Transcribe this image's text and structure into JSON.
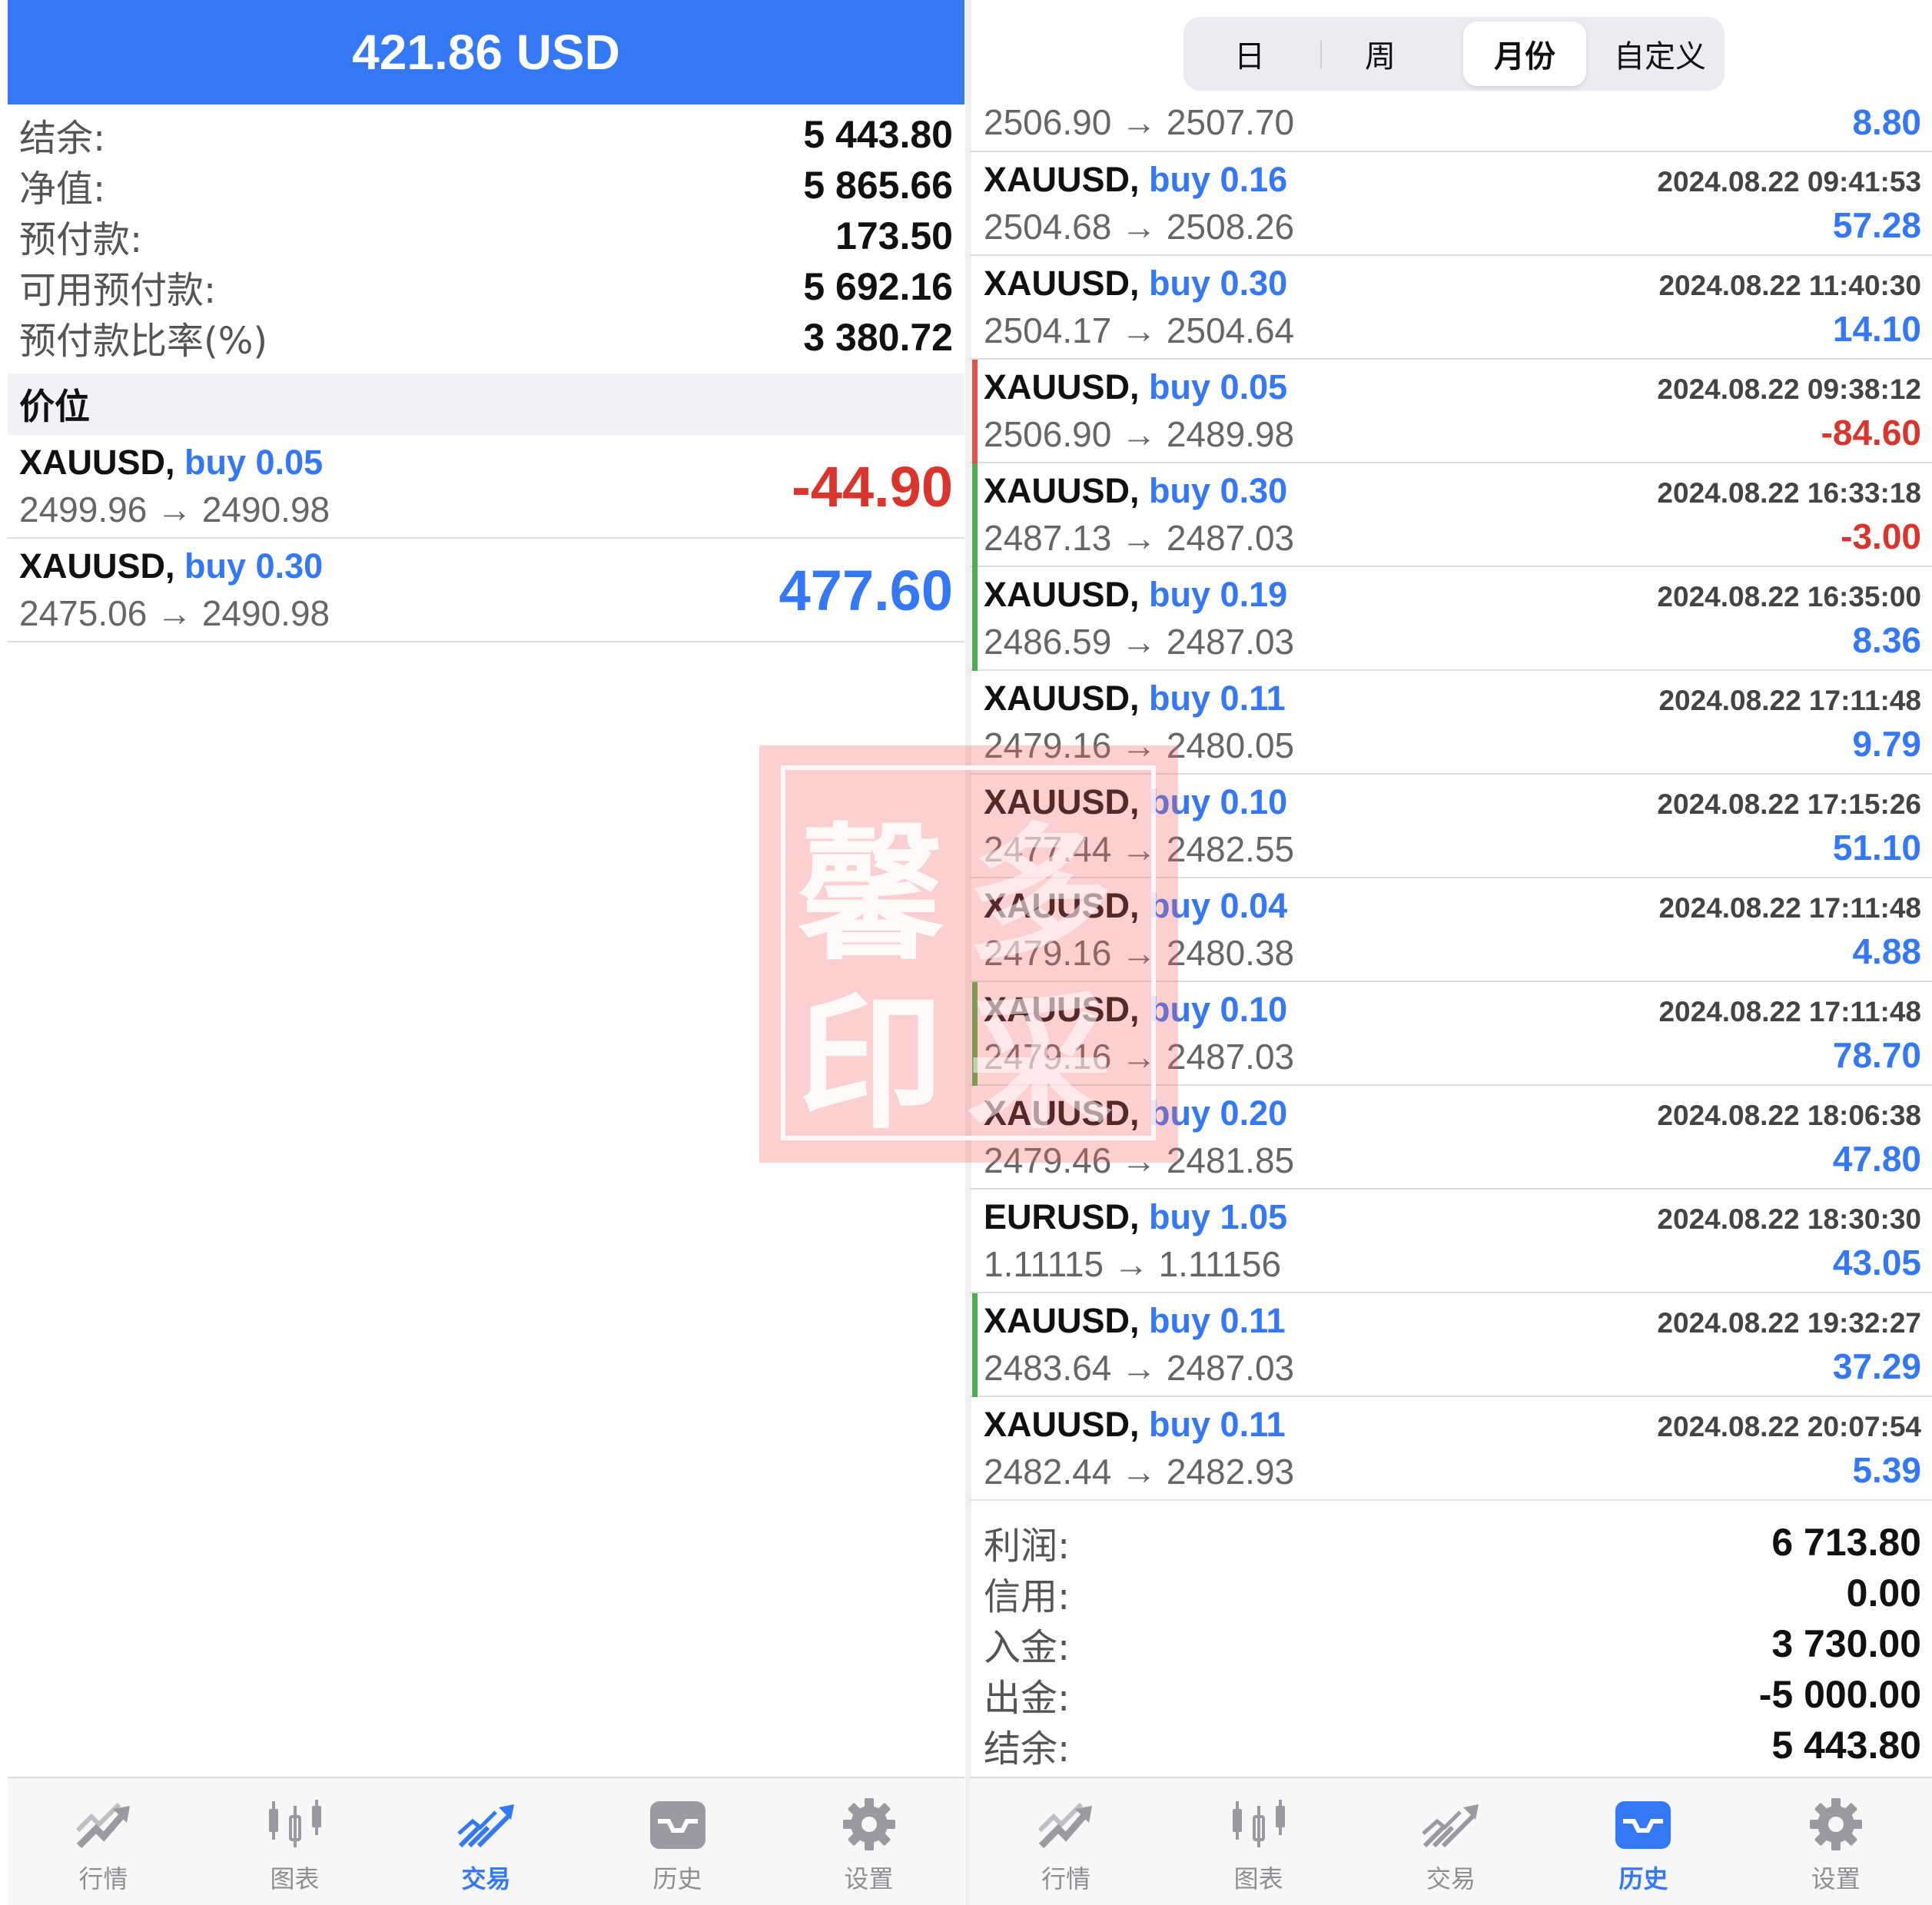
{
  "left": {
    "header": "421.86 USD",
    "summary": [
      {
        "label": "结余:",
        "value": "5 443.80"
      },
      {
        "label": "净值:",
        "value": "5 865.66"
      },
      {
        "label": "预付款:",
        "value": "173.50"
      },
      {
        "label": "可用预付款:",
        "value": "5 692.16"
      },
      {
        "label": "预付款比率(%)",
        "value": "3 380.72"
      }
    ],
    "section_title": "价位",
    "positions": [
      {
        "symbol": "XAUUSD,",
        "action": "buy 0.05",
        "prices": "2499.96 → 2490.98",
        "profit": "-44.90",
        "sign": "neg"
      },
      {
        "symbol": "XAUUSD,",
        "action": "buy 0.30",
        "prices": "2475.06 → 2490.98",
        "profit": "477.60",
        "sign": "pos"
      }
    ]
  },
  "right": {
    "segments": [
      "日",
      "周",
      "月份",
      "自定义"
    ],
    "active_segment": "月份",
    "partial_row": {
      "prices": "2506.90 → 2507.70",
      "profit": "8.80"
    },
    "deals": [
      {
        "symbol": "XAUUSD,",
        "action": "buy 0.16",
        "time": "2024.08.22 09:41:53",
        "prices": "2504.68 → 2508.26",
        "profit": "57.28",
        "sign": "pos",
        "mark": ""
      },
      {
        "symbol": "XAUUSD,",
        "action": "buy 0.30",
        "time": "2024.08.22 11:40:30",
        "prices": "2504.17 → 2504.64",
        "profit": "14.10",
        "sign": "pos",
        "mark": ""
      },
      {
        "symbol": "XAUUSD,",
        "action": "buy 0.05",
        "time": "2024.08.22 09:38:12",
        "prices": "2506.90 → 2489.98",
        "profit": "-84.60",
        "sign": "neg",
        "mark": "#e0524a"
      },
      {
        "symbol": "XAUUSD,",
        "action": "buy 0.30",
        "time": "2024.08.22 16:33:18",
        "prices": "2487.13 → 2487.03",
        "profit": "-3.00",
        "sign": "neg",
        "mark": "#4cb050"
      },
      {
        "symbol": "XAUUSD,",
        "action": "buy 0.19",
        "time": "2024.08.22 16:35:00",
        "prices": "2486.59 → 2487.03",
        "profit": "8.36",
        "sign": "pos",
        "mark": "#4cb050"
      },
      {
        "symbol": "XAUUSD,",
        "action": "buy 0.11",
        "time": "2024.08.22 17:11:48",
        "prices": "2479.16 → 2480.05",
        "profit": "9.79",
        "sign": "pos",
        "mark": ""
      },
      {
        "symbol": "XAUUSD,",
        "action": "buy 0.10",
        "time": "2024.08.22 17:15:26",
        "prices": "2477.44 → 2482.55",
        "profit": "51.10",
        "sign": "pos",
        "mark": ""
      },
      {
        "symbol": "XAUUSD,",
        "action": "buy 0.04",
        "time": "2024.08.22 17:11:48",
        "prices": "2479.16 → 2480.38",
        "profit": "4.88",
        "sign": "pos",
        "mark": ""
      },
      {
        "symbol": "XAUUSD,",
        "action": "buy 0.10",
        "time": "2024.08.22 17:11:48",
        "prices": "2479.16 → 2487.03",
        "profit": "78.70",
        "sign": "pos",
        "mark": "#4cb050"
      },
      {
        "symbol": "XAUUSD,",
        "action": "buy 0.20",
        "time": "2024.08.22 18:06:38",
        "prices": "2479.46 → 2481.85",
        "profit": "47.80",
        "sign": "pos",
        "mark": ""
      },
      {
        "symbol": "EURUSD,",
        "action": "buy 1.05",
        "time": "2024.08.22 18:30:30",
        "prices": "1.11115 → 1.11156",
        "profit": "43.05",
        "sign": "pos",
        "mark": ""
      },
      {
        "symbol": "XAUUSD,",
        "action": "buy 0.11",
        "time": "2024.08.22 19:32:27",
        "prices": "2483.64 → 2487.03",
        "profit": "37.29",
        "sign": "pos",
        "mark": "#4cb050"
      },
      {
        "symbol": "XAUUSD,",
        "action": "buy 0.11",
        "time": "2024.08.22 20:07:54",
        "prices": "2482.44 → 2482.93",
        "profit": "5.39",
        "sign": "pos",
        "mark": ""
      }
    ],
    "totals": [
      {
        "label": "利润:",
        "value": "6 713.80"
      },
      {
        "label": "信用:",
        "value": "0.00"
      },
      {
        "label": "入金:",
        "value": "3 730.00"
      },
      {
        "label": "出金:",
        "value": "-5 000.00"
      },
      {
        "label": "结余:",
        "value": "5 443.80"
      }
    ]
  },
  "tabbar": {
    "tabs": [
      {
        "label": "行情",
        "icon": "quotes-icon"
      },
      {
        "label": "图表",
        "icon": "chart-icon"
      },
      {
        "label": "交易",
        "icon": "trade-icon"
      },
      {
        "label": "历史",
        "icon": "history-icon"
      },
      {
        "label": "设置",
        "icon": "settings-icon"
      }
    ],
    "left_active": "交易",
    "right_active": "历史"
  },
  "watermark": {
    "chars": [
      "馨",
      "印",
      "多",
      "采"
    ]
  },
  "colors": {
    "accent": "#3478f6",
    "negative": "#d9352c",
    "positive_mark": "#4cb050",
    "negative_mark": "#e0524a"
  }
}
